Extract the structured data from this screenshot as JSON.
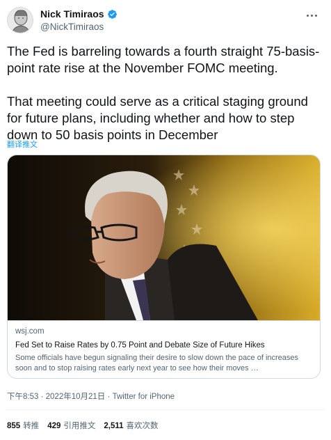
{
  "user": {
    "display_name": "Nick Timiraos",
    "handle": "@NickTimiraos"
  },
  "tweet": {
    "paragraph1": "The Fed is barreling towards a fourth straight 75-basis-point rate rise at the November FOMC meeting.",
    "paragraph2": "That meeting could serve as a critical staging ground for future plans, including whether and how to step down to 50 basis points in December",
    "translate_label": "翻译推文"
  },
  "card": {
    "domain": "wsj.com",
    "title": "Fed Set to Raise Rates by 0.75 Point and Debate Size of Future Hikes",
    "description": "Some officials have begun signaling their desire to slow down the pace of increases soon and to stop raising rates early next year to see how their moves …"
  },
  "meta": {
    "time": "下午8:53",
    "separator1": "·",
    "date": "2022年10月21日",
    "separator2": "·",
    "source": "Twitter for iPhone"
  },
  "stats": {
    "retweets_count": "855",
    "retweets_label": "转推",
    "quotes_count": "429",
    "quotes_label": "引用推文",
    "likes_count": "2,511",
    "likes_label": "喜欢次数"
  },
  "colors": {
    "accent": "#1d9bf0",
    "text_primary": "#0f1419",
    "text_secondary": "#536471",
    "border": "#cfd9de"
  },
  "icons": {
    "verified": "verified-badge-icon",
    "more": "more-icon"
  }
}
